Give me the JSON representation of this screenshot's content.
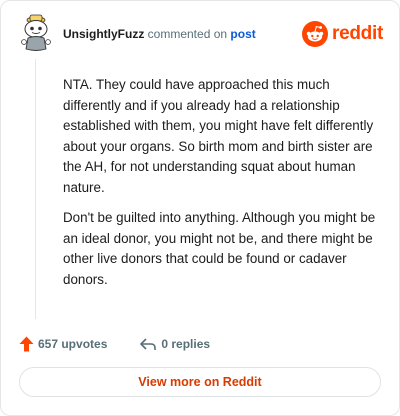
{
  "header": {
    "username": "UnsightlyFuzz",
    "action_text": "commented on",
    "post_link": "post",
    "brand_word": "reddit",
    "brand_color": "#ff4500"
  },
  "comment": {
    "paragraphs": [
      "NTA. They could have approached this much differently and if you already had a relationship established with them, you might have felt differently about your organs. So birth mom and birth sister are the AH, for not understanding squat about human nature.",
      "Don't be guilted into anything. Although you might be an ideal donor, you might not be, and there might be other live donors that could be found or cadaver donors."
    ]
  },
  "actions": {
    "upvotes_label": "657 upvotes",
    "replies_label": "0 replies",
    "upvote_icon": "upvote-arrow-icon",
    "reply_icon": "reply-arrow-icon"
  },
  "footer": {
    "view_more_label": "View more on Reddit"
  },
  "colors": {
    "accent": "#ff4500",
    "link": "#0b5ad9",
    "muted": "#576f76",
    "view_more_text": "#d93a00"
  }
}
